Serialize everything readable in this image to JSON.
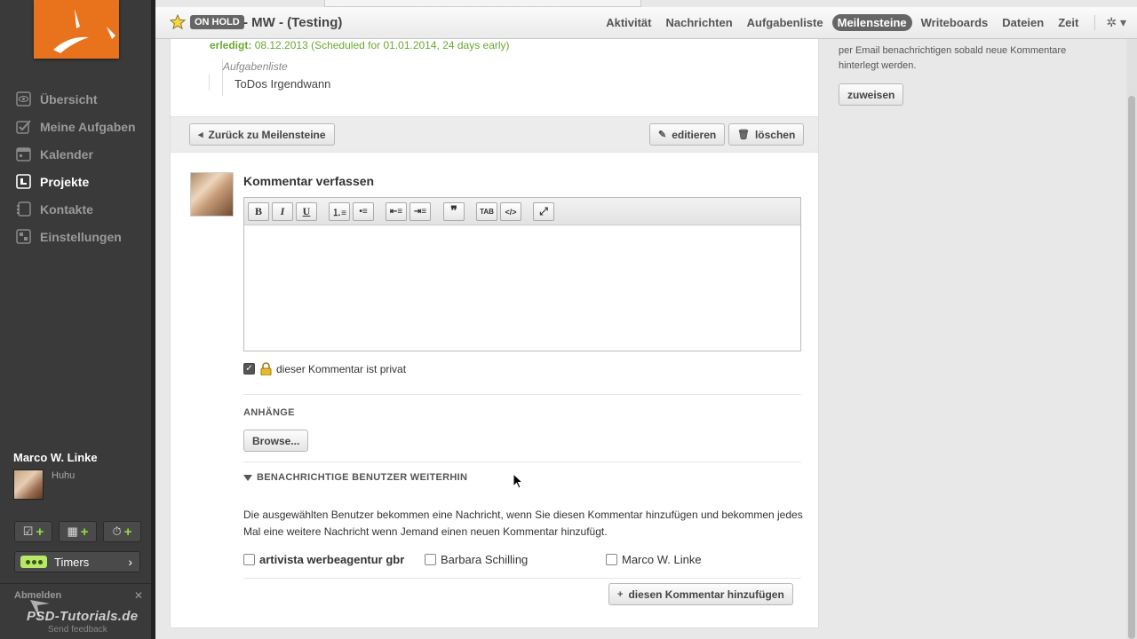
{
  "sidebar": {
    "nav": [
      {
        "label": "Übersicht",
        "icon": "eye-icon"
      },
      {
        "label": "Meine Aufgaben",
        "icon": "checkbox-icon"
      },
      {
        "label": "Kalender",
        "icon": "calendar-icon"
      },
      {
        "label": "Projekte",
        "icon": "projects-icon",
        "active": true
      },
      {
        "label": "Kontakte",
        "icon": "contacts-icon"
      },
      {
        "label": "Einstellungen",
        "icon": "settings-icon"
      }
    ],
    "user_name": "Marco W. Linke",
    "user_status": "Huhu",
    "timers_label": "Timers",
    "logout_label": "Abmelden",
    "feedback_label": "Send feedback",
    "watermark": "PSD-Tutorials.de"
  },
  "header": {
    "status_badge": "ON HOLD",
    "project_title": "- MW - (Testing)",
    "menu": [
      "Aktivität",
      "Nachrichten",
      "Aufgabenliste",
      "Meilensteine",
      "Writeboards",
      "Dateien",
      "Zeit"
    ],
    "active_menu": "Meilensteine"
  },
  "milestone": {
    "done_label": "erledigt:",
    "done_text": "08.12.2013 (Scheduled for 01.01.2014, 24 days early)",
    "tasklist_label": "Aufgabenliste",
    "tasklist_item": "ToDos Irgendwann"
  },
  "toolbar": {
    "back_label": "Zurück zu Meilensteine",
    "edit_label": "editieren",
    "delete_label": "löschen"
  },
  "comment": {
    "title": "Kommentar verfassen",
    "editor_buttons": [
      "B",
      "I",
      "U",
      "ordered-list-icon",
      "unordered-list-icon",
      "outdent-icon",
      "indent-icon",
      "quote-icon",
      "tab-icon",
      "html-icon",
      "fullscreen-icon"
    ],
    "body_value": "",
    "private_label": "dieser Kommentar ist privat",
    "private_checked": true,
    "attachments_label": "ANHÄNGE",
    "browse_label": "Browse...",
    "notify_label": "BENACHRICHTIGE BENUTZER WEITERHIN",
    "notify_text": "Die ausgewählten Benutzer bekommen eine Nachricht, wenn Sie diesen Kommentar hinzufügen und bekommen jedes Mal eine weitere Nachricht wenn Jemand einen neuen Kommentar hinzufügt.",
    "people": [
      "artivista werbeagentur gbr",
      "Barbara Schilling",
      "Marco W. Linke"
    ],
    "submit_label": "diesen Kommentar hinzufügen"
  },
  "right_panel": {
    "text": "per Email benachrichtigen sobald neue Kommentare hinterlegt werden.",
    "assign_label": "zuweisen"
  },
  "colors": {
    "accent_orange": "#e8731c",
    "done_green": "#6aa832",
    "timer_green": "#b8e868"
  }
}
